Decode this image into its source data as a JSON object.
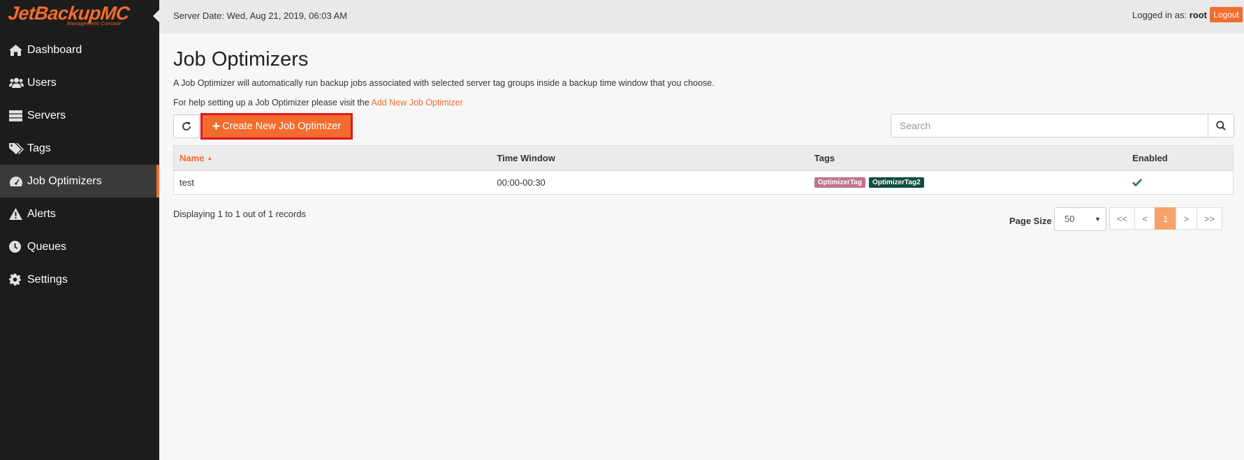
{
  "logo": {
    "main": "JetBackupMC",
    "sub": "Management Console"
  },
  "sidebar": {
    "items": [
      {
        "label": "Dashboard",
        "icon": "home-icon"
      },
      {
        "label": "Users",
        "icon": "users-icon"
      },
      {
        "label": "Servers",
        "icon": "servers-icon"
      },
      {
        "label": "Tags",
        "icon": "tags-icon"
      },
      {
        "label": "Job Optimizers",
        "icon": "dashboard-gauge-icon",
        "active": true
      },
      {
        "label": "Alerts",
        "icon": "warning-icon"
      },
      {
        "label": "Queues",
        "icon": "clock-icon"
      },
      {
        "label": "Settings",
        "icon": "gear-icon"
      }
    ]
  },
  "header": {
    "server_date": "Server Date: Wed, Aug 21, 2019, 06:03 AM",
    "logged_in_prefix": "Logged in as:",
    "user": "root",
    "separator": "|",
    "logout_label": "Logout"
  },
  "main": {
    "title": "Job Optimizers",
    "description": "A Job Optimizer will automatically run backup jobs associated with selected server tag groups inside a backup time window that you choose.",
    "help_prefix": "For help setting up a Job Optimizer please visit the",
    "help_link": "Add New Job Optimizer",
    "create_label": "Create New Job Optimizer",
    "search_placeholder": "Search"
  },
  "table": {
    "columns": [
      "Name",
      "Time Window",
      "Tags",
      "Enabled"
    ],
    "rows": [
      {
        "name": "test",
        "time_window": "00:00-00:30",
        "tags": [
          {
            "label": "OptimizerTag",
            "color": "#c0728f"
          },
          {
            "label": "OptimizerTag2",
            "color": "#0f4d3e"
          }
        ],
        "enabled": true
      }
    ]
  },
  "footer": {
    "records": "Displaying 1 to 1 out of 1 records",
    "page_size_label": "Page Size",
    "page_size_value": "50",
    "pager": [
      "<<",
      "<",
      "1",
      ">",
      ">>"
    ]
  },
  "colors": {
    "accent": "#f26c2e",
    "sidebar_bg": "#1c1c1c",
    "highlight_border": "#e0191e"
  }
}
